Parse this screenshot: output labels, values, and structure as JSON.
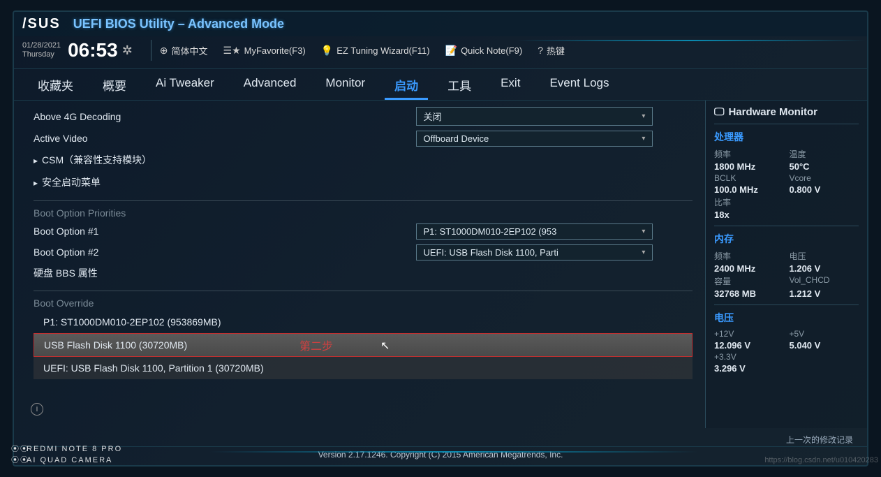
{
  "brand": "/SUS",
  "title": "UEFI BIOS Utility – Advanced Mode",
  "date": "01/28/2021",
  "day": "Thursday",
  "time": "06:53",
  "toolbar": {
    "lang": "简体中文",
    "fav": "MyFavorite(F3)",
    "ez": "EZ Tuning Wizard(F11)",
    "note": "Quick Note(F9)",
    "hotkey": "热键"
  },
  "tabs": [
    "收藏夹",
    "概要",
    "Ai Tweaker",
    "Advanced",
    "Monitor",
    "启动",
    "工具",
    "Exit",
    "Event Logs"
  ],
  "active_tab": 5,
  "settings": {
    "above4g": {
      "label": "Above 4G Decoding",
      "value": "关闭"
    },
    "activevideo": {
      "label": "Active Video",
      "value": "Offboard Device"
    },
    "csm": "CSM（兼容性支持模块）",
    "secureboot": "安全启动菜单",
    "boot_priorities": "Boot Option Priorities",
    "boot1": {
      "label": "Boot Option #1",
      "value": "P1: ST1000DM010-2EP102  (953"
    },
    "boot2": {
      "label": "Boot Option #2",
      "value": "UEFI: USB Flash Disk 1100, Parti"
    },
    "hdd_bbs": "硬盘 BBS 属性",
    "boot_override": "Boot Override",
    "overrides": [
      "P1: ST1000DM010-2EP102  (953869MB)",
      "USB Flash Disk 1100  (30720MB)",
      "UEFI: USB Flash Disk 1100, Partition 1 (30720MB)"
    ],
    "annotation": "第二步"
  },
  "hw": {
    "title": "Hardware Monitor",
    "cpu": {
      "title": "处理器",
      "freq_l": "频率",
      "freq_v": "1800 MHz",
      "temp_l": "温度",
      "temp_v": "50°C",
      "bclk_l": "BCLK",
      "bclk_v": "100.0 MHz",
      "vcore_l": "Vcore",
      "vcore_v": "0.800 V",
      "ratio_l": "比率",
      "ratio_v": "18x"
    },
    "mem": {
      "title": "内存",
      "freq_l": "频率",
      "freq_v": "2400 MHz",
      "volt_l": "电压",
      "volt_v": "1.206 V",
      "cap_l": "容量",
      "cap_v": "32768 MB",
      "vch_l": "Vol_CHCD",
      "vch_v": "1.212 V"
    },
    "volt": {
      "title": "电压",
      "v12_l": "+12V",
      "v12_v": "12.096 V",
      "v5_l": "+5V",
      "v5_v": "5.040 V",
      "v33_l": "+3.3V",
      "v33_v": "3.296 V"
    }
  },
  "footer": {
    "version": "Version 2.17.1246. Copyright (C) 2015 American Megatrends, Inc.",
    "lastmod": "上一次的修改记录"
  },
  "watermark": "https://blog.csdn.net/u010420283",
  "camera": {
    "l1": "REDMI NOTE 8 PRO",
    "l2": "AI QUAD CAMERA"
  }
}
